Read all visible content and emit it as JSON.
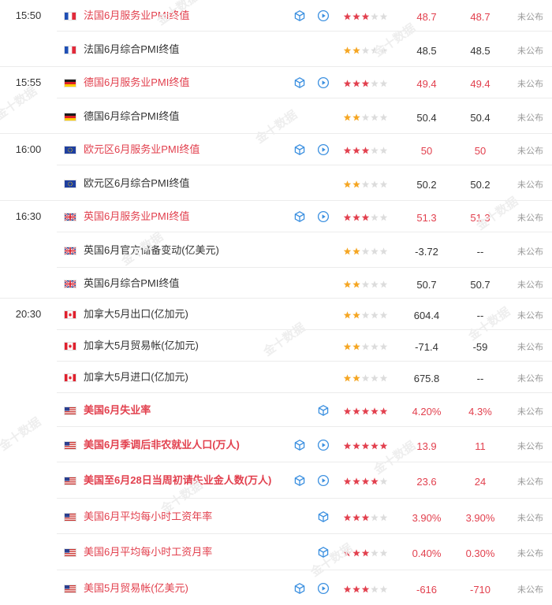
{
  "rows": [
    {
      "time": "15:50",
      "country": "fr",
      "name": "法国6月服务业PMI终值",
      "highlight": true,
      "bold": false,
      "icons": [
        "cube",
        "play"
      ],
      "stars": 3,
      "star_color": "red",
      "previous": "48.7",
      "previous_red": true,
      "forecast": "48.7",
      "forecast_red": true,
      "status": "未公布"
    },
    {
      "time": "",
      "country": "fr",
      "name": "法国6月综合PMI终值",
      "highlight": false,
      "bold": false,
      "icons": [],
      "stars": 2,
      "star_color": "orange",
      "previous": "48.5",
      "previous_red": false,
      "forecast": "48.5",
      "forecast_red": false,
      "status": "未公布"
    },
    {
      "time": "15:55",
      "country": "de",
      "name": "德国6月服务业PMI终值",
      "highlight": true,
      "bold": false,
      "icons": [
        "cube",
        "play"
      ],
      "stars": 3,
      "star_color": "red",
      "previous": "49.4",
      "previous_red": true,
      "forecast": "49.4",
      "forecast_red": true,
      "status": "未公布"
    },
    {
      "time": "",
      "country": "de",
      "name": "德国6月综合PMI终值",
      "highlight": false,
      "bold": false,
      "icons": [],
      "stars": 2,
      "star_color": "orange",
      "previous": "50.4",
      "previous_red": false,
      "forecast": "50.4",
      "forecast_red": false,
      "status": "未公布"
    },
    {
      "time": "16:00",
      "country": "eu",
      "name": "欧元区6月服务业PMI终值",
      "highlight": true,
      "bold": false,
      "icons": [
        "cube",
        "play"
      ],
      "stars": 3,
      "star_color": "red",
      "previous": "50",
      "previous_red": true,
      "forecast": "50",
      "forecast_red": true,
      "status": "未公布"
    },
    {
      "time": "",
      "country": "eu",
      "name": "欧元区6月综合PMI终值",
      "highlight": false,
      "bold": false,
      "icons": [],
      "stars": 2,
      "star_color": "orange",
      "previous": "50.2",
      "previous_red": false,
      "forecast": "50.2",
      "forecast_red": false,
      "status": "未公布"
    },
    {
      "time": "16:30",
      "country": "gb",
      "name": "英国6月服务业PMI终值",
      "highlight": true,
      "bold": false,
      "icons": [
        "cube",
        "play"
      ],
      "stars": 3,
      "star_color": "red",
      "previous": "51.3",
      "previous_red": true,
      "forecast": "51.3",
      "forecast_red": true,
      "status": "未公布"
    },
    {
      "time": "",
      "country": "gb",
      "name": "英国6月官方储备变动(亿美元)",
      "highlight": false,
      "bold": false,
      "icons": [],
      "stars": 2,
      "star_color": "orange",
      "previous": "-3.72",
      "previous_red": false,
      "forecast": "--",
      "forecast_red": false,
      "status": "未公布"
    },
    {
      "time": "",
      "country": "gb",
      "name": "英国6月综合PMI终值",
      "highlight": false,
      "bold": false,
      "icons": [],
      "stars": 2,
      "star_color": "orange",
      "previous": "50.7",
      "previous_red": false,
      "forecast": "50.7",
      "forecast_red": false,
      "status": "未公布"
    },
    {
      "time": "20:30",
      "country": "ca",
      "name": "加拿大5月出口(亿加元)",
      "highlight": false,
      "bold": false,
      "icons": [],
      "stars": 2,
      "star_color": "orange",
      "previous": "604.4",
      "previous_red": false,
      "forecast": "--",
      "forecast_red": false,
      "status": "未公布"
    },
    {
      "time": "",
      "country": "ca",
      "name": "加拿大5月贸易帐(亿加元)",
      "highlight": false,
      "bold": false,
      "icons": [],
      "stars": 2,
      "star_color": "orange",
      "previous": "-71.4",
      "previous_red": false,
      "forecast": "-59",
      "forecast_red": false,
      "status": "未公布"
    },
    {
      "time": "",
      "country": "ca",
      "name": "加拿大5月进口(亿加元)",
      "highlight": false,
      "bold": false,
      "icons": [],
      "stars": 2,
      "star_color": "orange",
      "previous": "675.8",
      "previous_red": false,
      "forecast": "--",
      "forecast_red": false,
      "status": "未公布"
    },
    {
      "time": "",
      "country": "us",
      "name": "美国6月失业率",
      "highlight": true,
      "bold": true,
      "icons": [
        "cube"
      ],
      "stars": 5,
      "star_color": "red",
      "previous": "4.20%",
      "previous_red": true,
      "forecast": "4.3%",
      "forecast_red": true,
      "status": "未公布"
    },
    {
      "time": "",
      "country": "us",
      "name": "美国6月季调后非农就业人口(万人)",
      "highlight": true,
      "bold": true,
      "icons": [
        "cube",
        "play"
      ],
      "stars": 5,
      "star_color": "red",
      "previous": "13.9",
      "previous_red": true,
      "forecast": "11",
      "forecast_red": true,
      "status": "未公布"
    },
    {
      "time": "",
      "country": "us",
      "name": "美国至6月28日当周初请失业金人数(万人)",
      "highlight": true,
      "bold": true,
      "icons": [
        "cube",
        "play"
      ],
      "stars": 4,
      "star_color": "red",
      "previous": "23.6",
      "previous_red": true,
      "forecast": "24",
      "forecast_red": true,
      "status": "未公布"
    },
    {
      "time": "",
      "country": "us",
      "name": "美国6月平均每小时工资年率",
      "highlight": true,
      "bold": false,
      "icons": [
        "cube"
      ],
      "stars": 3,
      "star_color": "red",
      "previous": "3.90%",
      "previous_red": true,
      "forecast": "3.90%",
      "forecast_red": true,
      "status": "未公布"
    },
    {
      "time": "",
      "country": "us",
      "name": "美国6月平均每小时工资月率",
      "highlight": true,
      "bold": false,
      "icons": [
        "cube"
      ],
      "stars": 3,
      "star_color": "red",
      "previous": "0.40%",
      "previous_red": true,
      "forecast": "0.30%",
      "forecast_red": true,
      "status": "未公布"
    },
    {
      "time": "",
      "country": "us",
      "name": "美国5月贸易帐(亿美元)",
      "highlight": true,
      "bold": false,
      "icons": [
        "cube",
        "play"
      ],
      "stars": 3,
      "star_color": "red",
      "previous": "-616",
      "previous_red": true,
      "forecast": "-710",
      "forecast_red": true,
      "status": "未公布"
    }
  ],
  "colors": {
    "red": "#e2404e",
    "orange": "#f5a623",
    "empty_star": "#dcdcdc",
    "icon_blue": "#3a8fe0",
    "divider": "#ececec",
    "muted": "#999999"
  },
  "icon_names": {
    "cube": "cube-icon",
    "play": "play-circle-icon"
  }
}
